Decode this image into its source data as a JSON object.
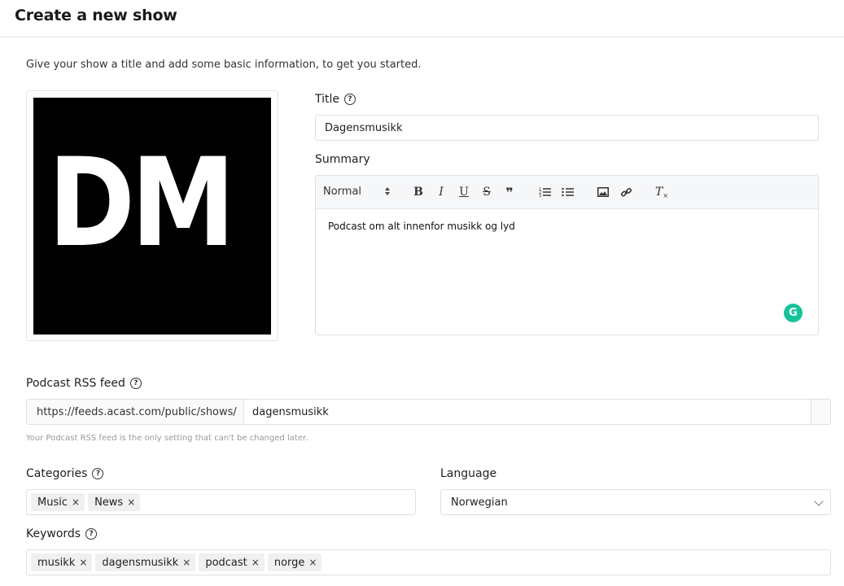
{
  "header": {
    "title": "Create a new show"
  },
  "intro": "Give your show a title and add some basic information, to get you started.",
  "artwork": {
    "text": "DM"
  },
  "title_field": {
    "label": "Title",
    "value": "Dagensmusikk"
  },
  "summary": {
    "label": "Summary",
    "format": "Normal",
    "format_arrows": "▲▼",
    "toolbar": {
      "bold": "B",
      "italic": "I",
      "underline": "U",
      "strike": "S",
      "quote": "❞",
      "ordered_list": "☰",
      "bullet_list": "☰",
      "image": "▣",
      "link": "🔗",
      "clear": "T"
    },
    "content": "Podcast om alt innenfor musikk og lyd",
    "grammarly": "G"
  },
  "rss": {
    "label": "Podcast RSS feed",
    "prefix": "https://feeds.acast.com/public/shows/",
    "value": "dagensmusikk",
    "hint": "Your Podcast RSS feed is the only setting that can't be changed later."
  },
  "categories": {
    "label": "Categories",
    "tags": [
      "Music",
      "News"
    ]
  },
  "language": {
    "label": "Language",
    "value": "Norwegian"
  },
  "keywords": {
    "label": "Keywords",
    "tags": [
      "musikk",
      "dagensmusikk",
      "podcast",
      "norge"
    ]
  },
  "help_glyph": "?",
  "remove_glyph": "×"
}
